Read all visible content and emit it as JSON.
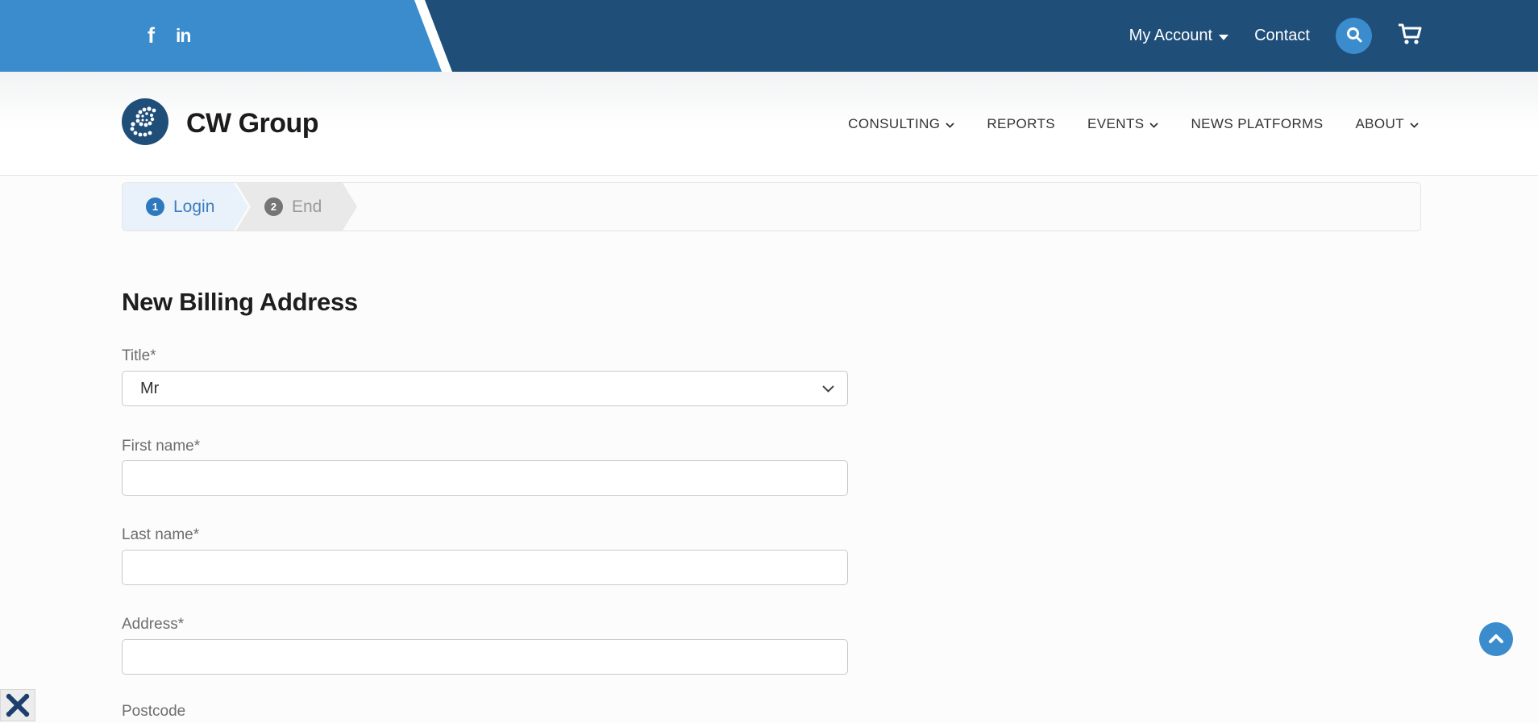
{
  "topbar": {
    "social": [
      {
        "name": "facebook"
      },
      {
        "name": "linkedin"
      }
    ],
    "my_account_label": "My Account",
    "contact_label": "Contact"
  },
  "header": {
    "brand": "CW Group",
    "nav": [
      {
        "label": "CONSULTING",
        "has_dropdown": true
      },
      {
        "label": "REPORTS",
        "has_dropdown": false
      },
      {
        "label": "EVENTS",
        "has_dropdown": true
      },
      {
        "label": "NEWS PLATFORMS",
        "has_dropdown": false
      },
      {
        "label": "ABOUT",
        "has_dropdown": true
      }
    ]
  },
  "wizard": {
    "steps": [
      {
        "number": "1",
        "label": "Login",
        "state": "active"
      },
      {
        "number": "2",
        "label": "End",
        "state": "inactive"
      }
    ]
  },
  "form": {
    "title": "New Billing Address",
    "fields": [
      {
        "label": "Title*",
        "type": "select",
        "value": "Mr"
      },
      {
        "label": "First name*",
        "type": "text",
        "value": ""
      },
      {
        "label": "Last name*",
        "type": "text",
        "value": ""
      },
      {
        "label": "Address*",
        "type": "text",
        "value": ""
      },
      {
        "label": "Postcode",
        "type": "text",
        "value": ""
      }
    ]
  },
  "colors": {
    "navy": "#1F4E79",
    "light_blue": "#3A8CCD",
    "step_active_bg": "#e9f1fa",
    "step_active_text": "#3d7ebf",
    "step_inactive_bg": "#e9e9e9",
    "step_inactive_text": "#9a9a9a"
  }
}
